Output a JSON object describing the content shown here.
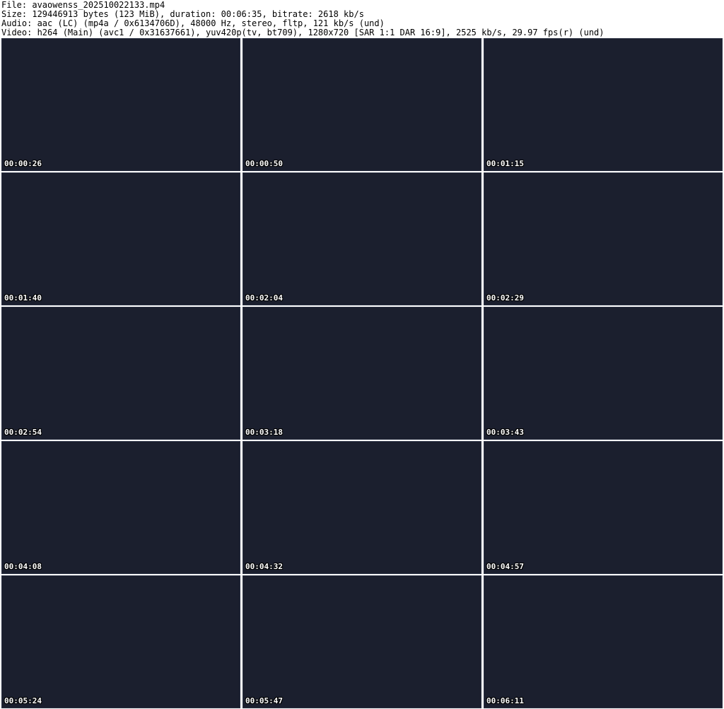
{
  "header": {
    "file": "File: avaowenss_202510022133.mp4",
    "size": "Size: 129446913 bytes (123 MiB), duration: 00:06:35, bitrate: 2618 kb/s",
    "audio": "Audio: aac (LC) (mp4a / 0x6134706D), 48000 Hz, stereo, fltp, 121 kb/s (und)",
    "video": "Video: h264 (Main) (avc1 / 0x31637661), yuv420p(tv, bt709), 1280x720 [SAR 1:1 DAR 16:9], 2525 kb/s, 29.97 fps(r) (und)"
  },
  "thumbnails": [
    {
      "timestamp": "00:00:26"
    },
    {
      "timestamp": "00:00:50"
    },
    {
      "timestamp": "00:01:15"
    },
    {
      "timestamp": "00:01:40"
    },
    {
      "timestamp": "00:02:04"
    },
    {
      "timestamp": "00:02:29"
    },
    {
      "timestamp": "00:02:54"
    },
    {
      "timestamp": "00:03:18"
    },
    {
      "timestamp": "00:03:43"
    },
    {
      "timestamp": "00:04:08"
    },
    {
      "timestamp": "00:04:32"
    },
    {
      "timestamp": "00:04:57"
    },
    {
      "timestamp": "00:05:24"
    },
    {
      "timestamp": "00:05:47"
    },
    {
      "timestamp": "00:06:11"
    }
  ]
}
